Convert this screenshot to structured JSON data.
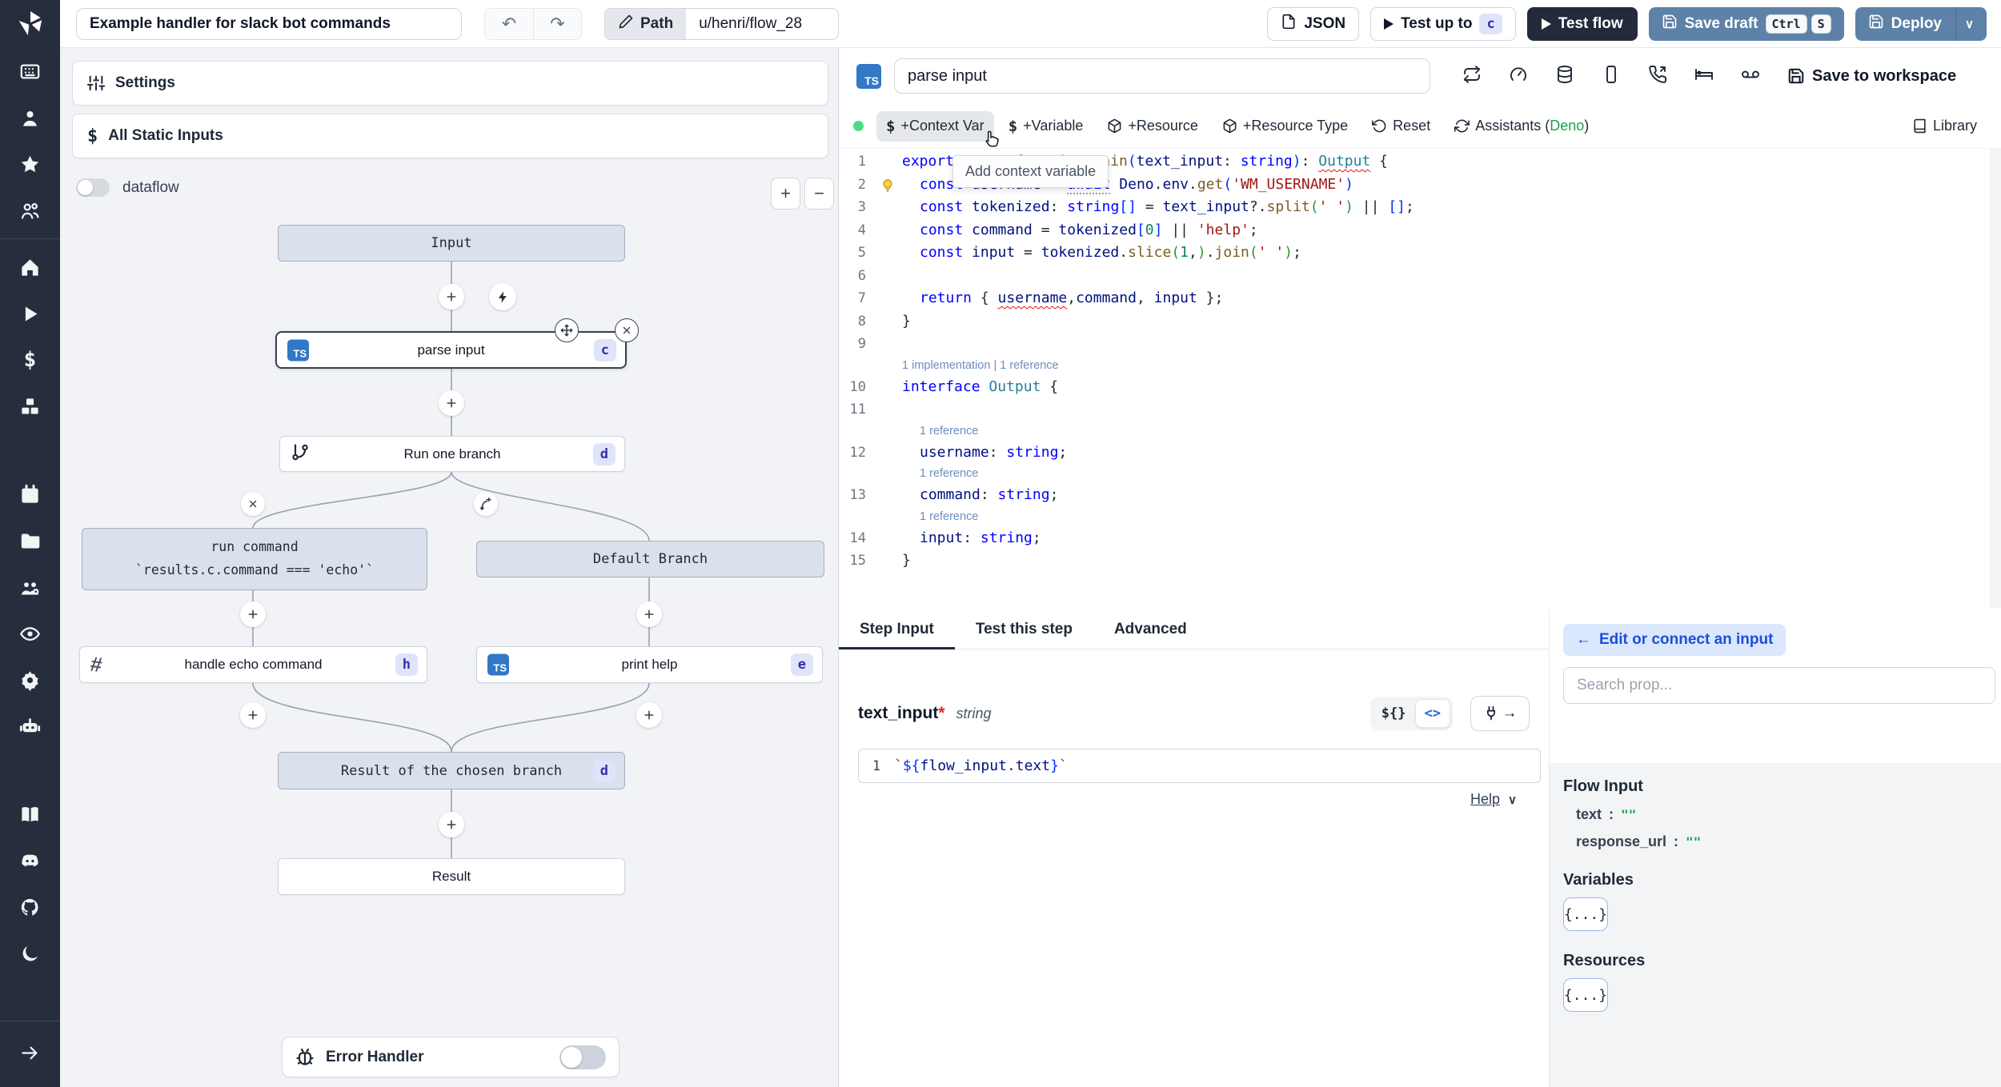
{
  "colors": {
    "accent_button": "#5e81a7",
    "dark_button": "#232b3b",
    "ts_badge": "#3178c6",
    "badge_bg": "#e0e4fb",
    "badge_text": "#3730a3",
    "status_green": "#4ade80",
    "deno_green": "#16a34a",
    "string_green": "#16a34a",
    "sidebar_bg": "#262e3e"
  },
  "icons": {
    "sidebar_groups": [
      [
        "workspace",
        "user",
        "favorites",
        "collaborators"
      ],
      [
        "home",
        "runs",
        "variables",
        "resources"
      ],
      [
        "schedules",
        "folders",
        "groups",
        "audit-logs",
        "settings",
        "workers"
      ],
      [
        "docs",
        "discord",
        "github",
        "dark-mode"
      ]
    ],
    "expand": "expand-arrow"
  },
  "topbar": {
    "title": "Example handler for slack bot commands",
    "undo": "↶",
    "redo": "↷",
    "path_label": "Path",
    "path_value": "u/henri/flow_28",
    "json_label": "JSON",
    "test_up_to_label": "Test up to",
    "test_up_to_badge": "c",
    "test_flow_label": "Test flow",
    "save_draft_label": "Save draft",
    "save_draft_keys": [
      "Ctrl",
      "S"
    ],
    "deploy_label": "Deploy",
    "deploy_chevron": "∨"
  },
  "left_panel": {
    "settings_label": "Settings",
    "static_inputs_label": "All Static Inputs",
    "dataflow_label": "dataflow",
    "zoom_in": "+",
    "zoom_out": "−",
    "error_handler_label": "Error Handler"
  },
  "graph": {
    "nodes": {
      "input": {
        "label": "Input"
      },
      "parse": {
        "label": "parse input",
        "badge": "c",
        "lang": "TS"
      },
      "run_one_branch": {
        "label": "Run one branch",
        "badge": "d"
      },
      "run_command": {
        "label": "run command",
        "sublabel": "`results.c.command === 'echo'`"
      },
      "default_branch": {
        "label": "Default Branch"
      },
      "handle_echo": {
        "label": "handle echo command",
        "badge": "h",
        "icon": "slack-hash"
      },
      "print_help": {
        "label": "print help",
        "badge": "e",
        "lang": "TS"
      },
      "result_chosen": {
        "label": "Result of the chosen branch",
        "badge": "d"
      },
      "result": {
        "label": "Result"
      }
    }
  },
  "editor": {
    "lang_badge": "TS",
    "step_name": "parse input",
    "header_icons": [
      "repeat",
      "gauge",
      "database",
      "mobile",
      "phone-incoming",
      "bed",
      "voicemail"
    ],
    "save_to_workspace_label": "Save to workspace",
    "tooltip": "Add context variable",
    "toolbar": {
      "items": [
        {
          "id": "context-var",
          "icon": "dollar",
          "label": "+Context Var",
          "highlight": true
        },
        {
          "id": "variable",
          "icon": "dollar",
          "label": "+Variable"
        },
        {
          "id": "resource",
          "icon": "package",
          "label": "+Resource"
        },
        {
          "id": "resource-type",
          "icon": "package",
          "label": "+Resource Type"
        },
        {
          "id": "reset",
          "icon": "rotate",
          "label": "Reset"
        },
        {
          "id": "assistants",
          "icon": "refresh",
          "label": "Assistants (",
          "accent": "Deno",
          "suffix": ")"
        }
      ],
      "library_label": "Library"
    },
    "code": {
      "lines": [
        {
          "n": "1",
          "t": [
            [
              "export",
              "kw"
            ],
            [
              " ",
              "pl"
            ],
            [
              "async",
              "kw"
            ],
            [
              " ",
              "pl"
            ],
            [
              "function",
              "kw"
            ],
            [
              " ",
              "pl"
            ],
            [
              "main",
              "fn"
            ],
            [
              "(",
              "pb"
            ],
            [
              "text_input",
              "vr"
            ],
            [
              ": ",
              "pl"
            ],
            [
              "string",
              "kw"
            ],
            [
              ")",
              "pb"
            ],
            [
              ": ",
              "pl"
            ],
            [
              "Output",
              "ty sq"
            ],
            [
              " {",
              "pl"
            ]
          ]
        },
        {
          "n": "2",
          "ind": true,
          "bulb": true,
          "t": [
            [
              "const",
              "kw"
            ],
            [
              " ",
              "pl"
            ],
            [
              "username",
              "vr"
            ],
            [
              " = ",
              "pl"
            ],
            [
              "await",
              "kw du"
            ],
            [
              " ",
              "pl"
            ],
            [
              "Deno",
              "vr"
            ],
            [
              ".",
              "pl"
            ],
            [
              "env",
              "vr"
            ],
            [
              ".",
              "pl"
            ],
            [
              "get",
              "fn"
            ],
            [
              "(",
              "pb"
            ],
            [
              "'WM_USERNAME'",
              "st"
            ],
            [
              ")",
              "pb"
            ]
          ]
        },
        {
          "n": "3",
          "ind": true,
          "t": [
            [
              "const",
              "kw"
            ],
            [
              " ",
              "pl"
            ],
            [
              "tokenized",
              "vr"
            ],
            [
              ": ",
              "pl"
            ],
            [
              "string",
              "kw"
            ],
            [
              "[]",
              "pb"
            ],
            [
              " = ",
              "pl"
            ],
            [
              "text_input",
              "vr"
            ],
            [
              "?.",
              "pl"
            ],
            [
              "split",
              "fn"
            ],
            [
              "(",
              "pg"
            ],
            [
              "' '",
              "st"
            ],
            [
              ")",
              "pg"
            ],
            [
              " || ",
              "pl"
            ],
            [
              "[]",
              "pb"
            ],
            [
              ";",
              "pl"
            ]
          ]
        },
        {
          "n": "4",
          "ind": true,
          "t": [
            [
              "const",
              "kw"
            ],
            [
              " ",
              "pl"
            ],
            [
              "command",
              "vr"
            ],
            [
              " = ",
              "pl"
            ],
            [
              "tokenized",
              "vr"
            ],
            [
              "[",
              "pb"
            ],
            [
              "0",
              "nu"
            ],
            [
              "]",
              "pb"
            ],
            [
              " || ",
              "pl"
            ],
            [
              "'help'",
              "st"
            ],
            [
              ";",
              "pl"
            ]
          ]
        },
        {
          "n": "5",
          "ind": true,
          "t": [
            [
              "const",
              "kw"
            ],
            [
              " ",
              "pl"
            ],
            [
              "input",
              "vr"
            ],
            [
              " = ",
              "pl"
            ],
            [
              "tokenized",
              "vr"
            ],
            [
              ".",
              "pl"
            ],
            [
              "slice",
              "fn"
            ],
            [
              "(",
              "pg"
            ],
            [
              "1",
              "nu"
            ],
            [
              ",",
              "pl"
            ],
            [
              ")",
              "pg"
            ],
            [
              ".",
              "pl"
            ],
            [
              "join",
              "fn"
            ],
            [
              "(",
              "pg"
            ],
            [
              "' '",
              "st"
            ],
            [
              ")",
              "pg"
            ],
            [
              ";",
              "pl"
            ]
          ]
        },
        {
          "n": "6",
          "t": []
        },
        {
          "n": "7",
          "ind": true,
          "t": [
            [
              "return",
              "kw"
            ],
            [
              " { ",
              "pl"
            ],
            [
              "username",
              "vr sq"
            ],
            [
              ",",
              "pl"
            ],
            [
              "command",
              "vr"
            ],
            [
              ", ",
              "pl"
            ],
            [
              "input",
              "vr"
            ],
            [
              " }",
              "pl"
            ],
            [
              ";",
              "pl"
            ]
          ]
        },
        {
          "n": "8",
          "t": [
            [
              "}",
              "pl"
            ]
          ]
        },
        {
          "n": "9",
          "t": []
        },
        {
          "lens": "1 implementation | 1 reference"
        },
        {
          "n": "10",
          "t": [
            [
              "interface",
              "kw"
            ],
            [
              " ",
              "pl"
            ],
            [
              "Output",
              "ty"
            ],
            [
              " {",
              "pl"
            ]
          ]
        },
        {
          "n": "11",
          "t": []
        },
        {
          "lens": "1 reference",
          "ind": true
        },
        {
          "n": "12",
          "ind": true,
          "t": [
            [
              "username",
              "vr"
            ],
            [
              ": ",
              "pl"
            ],
            [
              "string",
              "kw"
            ],
            [
              ";",
              "pl"
            ]
          ]
        },
        {
          "lens": "1 reference",
          "ind": true
        },
        {
          "n": "13",
          "ind": true,
          "t": [
            [
              "command",
              "vr"
            ],
            [
              ": ",
              "pl"
            ],
            [
              "string",
              "kw"
            ],
            [
              ";",
              "pl"
            ]
          ]
        },
        {
          "lens": "1 reference",
          "ind": true
        },
        {
          "n": "14",
          "ind": true,
          "t": [
            [
              "input",
              "vr"
            ],
            [
              ": ",
              "pl"
            ],
            [
              "string",
              "kw"
            ],
            [
              ";",
              "pl"
            ]
          ]
        },
        {
          "n": "15",
          "t": [
            [
              "}",
              "pl"
            ]
          ]
        }
      ]
    }
  },
  "bottom": {
    "tabs": [
      "Step Input",
      "Test this step",
      "Advanced"
    ],
    "field_name": "text_input",
    "field_required": "*",
    "field_type": "string",
    "seg_template": "${}",
    "seg_code": "<>",
    "expr_line_no": "1",
    "expr_tokens": [
      [
        "`",
        "st"
      ],
      [
        "${",
        "pb"
      ],
      [
        "flow_input",
        "vr"
      ],
      [
        ".",
        "pl"
      ],
      [
        "text",
        "vr"
      ],
      [
        "}",
        "pb"
      ],
      [
        "`",
        "st"
      ]
    ],
    "help_label": "Help",
    "help_chevron": "∨"
  },
  "connect_panel": {
    "back_arrow": "←",
    "back_label": "Edit or connect an input",
    "search_placeholder": "Search prop...",
    "flow_input_title": "Flow Input",
    "props": [
      {
        "key": "text",
        "colon": ":",
        "value": "\"\""
      },
      {
        "key": "response_url",
        "colon": ":",
        "value": "\"\""
      }
    ],
    "variables_title": "Variables",
    "variables_chip": "{...}",
    "resources_title": "Resources",
    "resources_chip": "{...}"
  }
}
